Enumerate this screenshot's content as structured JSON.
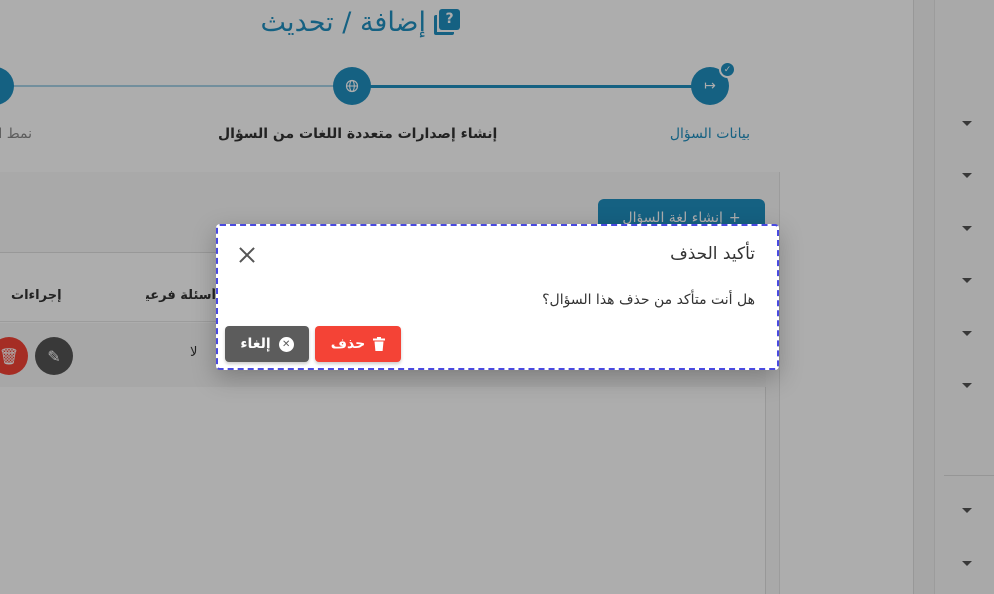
{
  "page": {
    "title": "إضافة / تحديث",
    "title_icon": "question-book-icon",
    "accent_color": "#1f8fc0"
  },
  "stepper": {
    "steps": [
      {
        "label": "بيانات السؤال",
        "icon": "arrow-right-icon",
        "status": "completed"
      },
      {
        "label": "إنشاء إصدارات متعددة اللغات من السؤال",
        "icon": "globe-icon",
        "status": "active"
      },
      {
        "label": "نمط ا",
        "icon": "step-icon",
        "status": "pending"
      }
    ]
  },
  "toolbar": {
    "add_language_label": "إنشاء لغة السؤال",
    "add_icon": "plus-icon"
  },
  "table": {
    "headers": {
      "actions": "إجراءات",
      "sub_questions": "أسئلة فرعية"
    },
    "rows": [
      {
        "sub_questions": "لا"
      }
    ]
  },
  "dialog": {
    "title": "تأكيد الحذف",
    "message": "هل أنت متأكد من حذف هذا السؤال؟",
    "delete_label": "حذف",
    "cancel_label": "إلغاء",
    "delete_color": "#f44336",
    "cancel_color": "#5c5c5c"
  }
}
